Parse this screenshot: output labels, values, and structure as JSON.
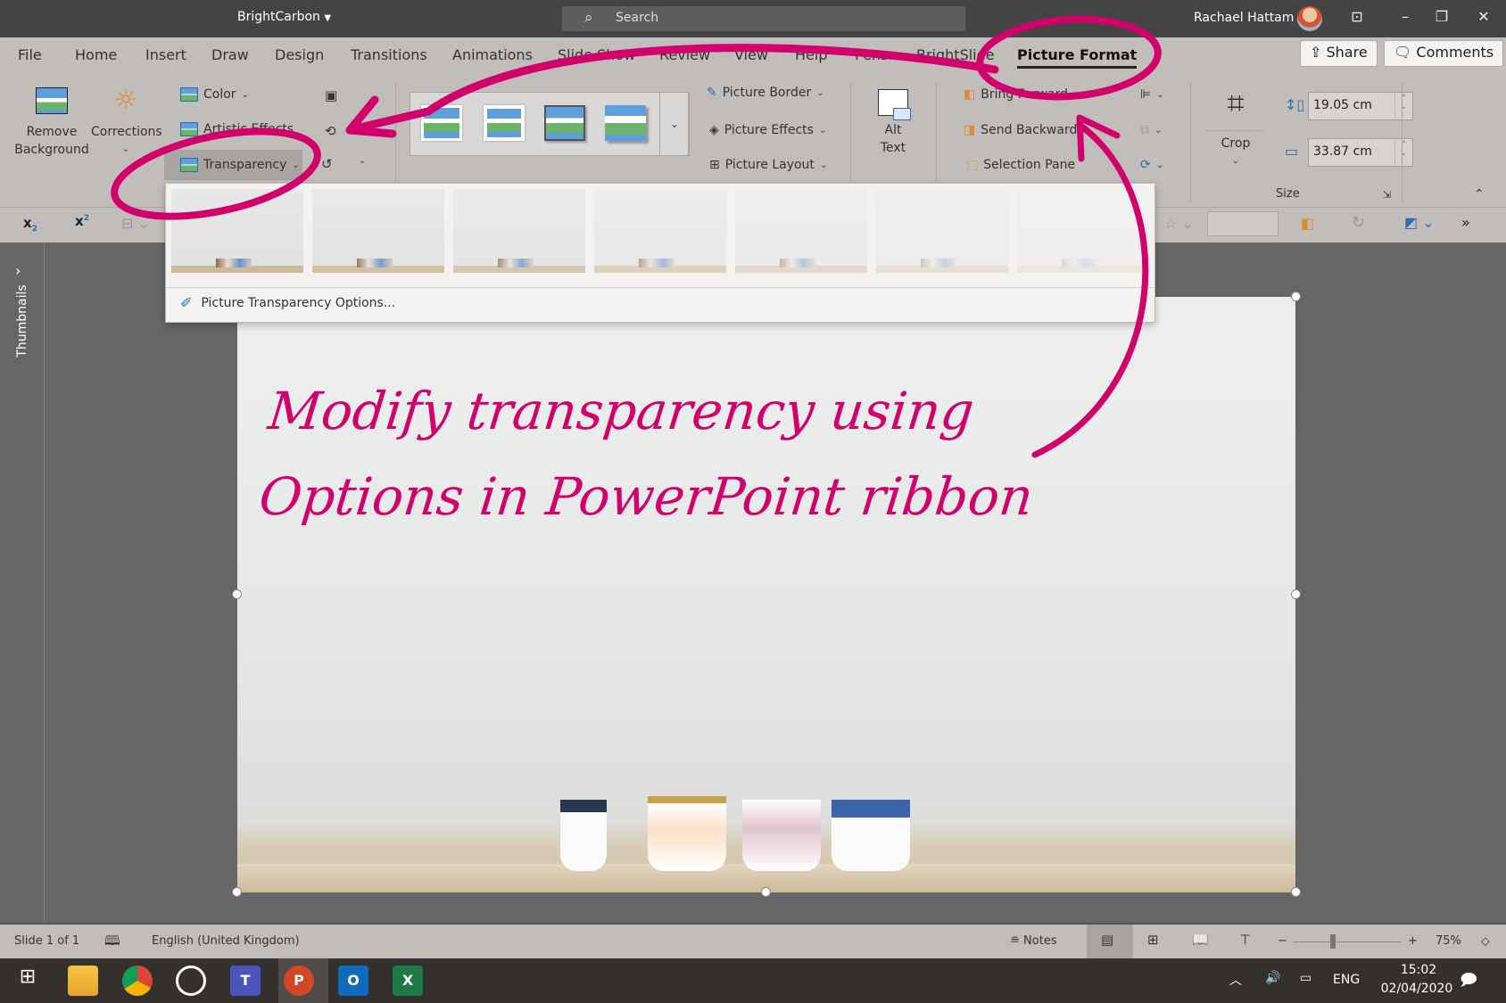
{
  "titlebar": {
    "app_title": "BrightCarbon",
    "search_placeholder": "Search",
    "user_name": "Rachael Hattam",
    "controls": [
      "ribbon-display-icon",
      "minimize-icon",
      "restore-icon",
      "close-icon"
    ]
  },
  "tabs": [
    {
      "label": "File"
    },
    {
      "label": "Home"
    },
    {
      "label": "Insert"
    },
    {
      "label": "Draw"
    },
    {
      "label": "Design"
    },
    {
      "label": "Transitions"
    },
    {
      "label": "Animations"
    },
    {
      "label": "Slide Show"
    },
    {
      "label": "Review"
    },
    {
      "label": "View"
    },
    {
      "label": "Help"
    },
    {
      "label": "Pens"
    },
    {
      "label": "BrightSlide"
    },
    {
      "label": "Picture Format",
      "active": true
    }
  ],
  "top_buttons": {
    "share": "Share",
    "comments": "Comments"
  },
  "ribbon": {
    "adjust": {
      "remove_background": [
        "Remove",
        "Background"
      ],
      "corrections": "Corrections",
      "color": "Color",
      "artistic_effects": "Artistic Effects",
      "transparency": "Transparency"
    },
    "picture_styles": {
      "border": "Picture Border",
      "effects": "Picture Effects",
      "layout": "Picture Layout"
    },
    "accessibility": {
      "alt_text": [
        "Alt",
        "Text"
      ]
    },
    "arrange": {
      "bring_forward": "Bring Forward",
      "send_backward": "Send Backward",
      "selection_pane": "Selection Pane"
    },
    "size": {
      "crop": "Crop",
      "height": "19.05 cm",
      "width": "33.87 cm",
      "group_label": "Size"
    }
  },
  "transparency_dropdown": {
    "presets": [
      "0%",
      "15%",
      "30%",
      "50%",
      "65%",
      "80%",
      "95%"
    ],
    "option": "Picture Transparency Options..."
  },
  "thumbnails_label": "Thumbnails",
  "slide": {
    "handwriting_line1": "Modify transparency using",
    "handwriting_line2": "Options in PowerPoint ribbon",
    "annotation_color": "#d1006b"
  },
  "statusbar": {
    "slide_counter": "Slide 1 of 1",
    "language": "English (United Kingdom)",
    "notes": "Notes",
    "zoom_level": "75%",
    "zoom_fraction": 0.37
  },
  "taskbar": {
    "apps": [
      "windows-start",
      "file-explorer",
      "chrome",
      "photos",
      "teams",
      "powerpoint",
      "outlook",
      "excel"
    ],
    "language": "ENG",
    "time": "15:02",
    "date": "02/04/2020"
  }
}
